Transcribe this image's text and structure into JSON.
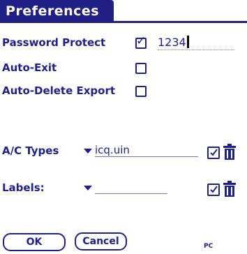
{
  "title": "Preferences",
  "password_protect": {
    "label": "Password Protect",
    "checked": true,
    "check_glyph": "✓",
    "value": "1234"
  },
  "auto_exit": {
    "label": "Auto-Exit",
    "checked": false
  },
  "auto_delete_export": {
    "label": "Auto-Delete Export",
    "checked": false
  },
  "ac_types": {
    "label": "A/C Types",
    "value": "icq.uin"
  },
  "labels_field": {
    "label": "Labels:",
    "value": ""
  },
  "buttons": {
    "ok": "OK",
    "cancel": "Cancel"
  },
  "footer_label": "PC",
  "colors": {
    "accent": "#1f1f86",
    "text": "#1e2091"
  }
}
